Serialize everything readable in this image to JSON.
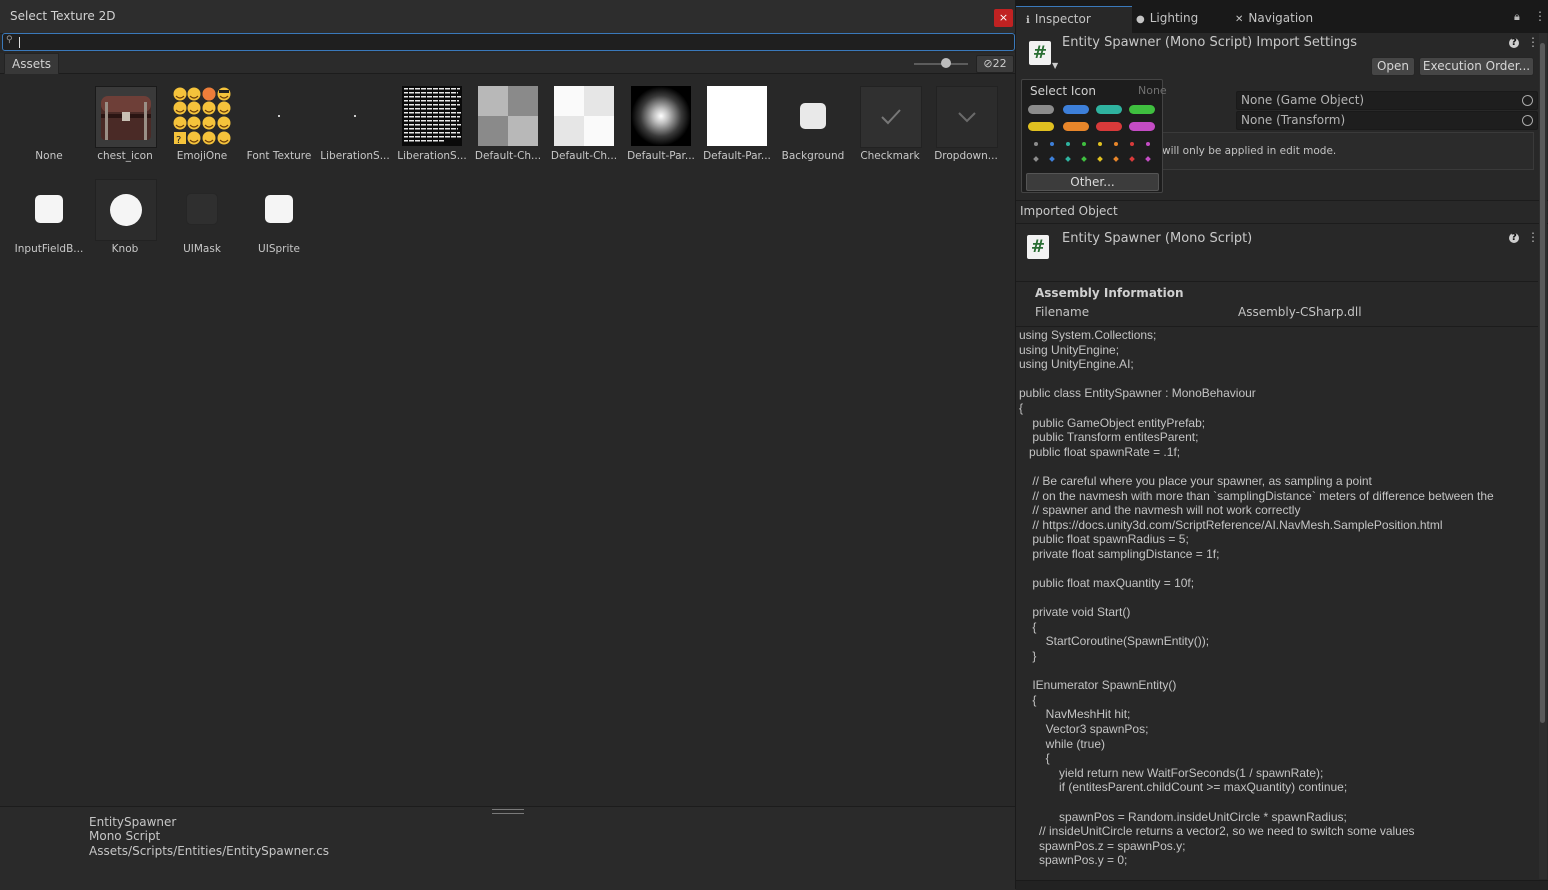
{
  "picker": {
    "title": "Select Texture 2D",
    "close_label": "×",
    "search": {
      "value": "",
      "placeholder": ""
    },
    "tab_label": "Assets",
    "hidden_count": "22",
    "assets": [
      {
        "name": "None"
      },
      {
        "name": "chest_icon"
      },
      {
        "name": "EmojiOne"
      },
      {
        "name": "Font Texture"
      },
      {
        "name": "LiberationS..."
      },
      {
        "name": "LiberationS..."
      },
      {
        "name": "Default-Ch..."
      },
      {
        "name": "Default-Ch..."
      },
      {
        "name": "Default-Par..."
      },
      {
        "name": "Default-Par..."
      },
      {
        "name": "Background"
      },
      {
        "name": "Checkmark"
      },
      {
        "name": "Dropdown..."
      },
      {
        "name": "InputFieldB..."
      },
      {
        "name": "Knob"
      },
      {
        "name": "UIMask"
      },
      {
        "name": "UISprite"
      }
    ],
    "preview": {
      "name": "EntitySpawner",
      "type": "Mono Script",
      "path": "Assets/Scripts/Entities/EntitySpawner.cs"
    }
  },
  "inspector": {
    "tabs": [
      {
        "label": "Inspector",
        "icon": "info-icon"
      },
      {
        "label": "Lighting",
        "icon": "bulb-icon"
      },
      {
        "label": "Navigation",
        "icon": "navigation-icon"
      }
    ],
    "header_title": "Entity Spawner (Mono Script) Import Settings",
    "buttons": {
      "open": "Open",
      "execution_order": "Execution Order..."
    },
    "fields": {
      "entity_prefab": "None (Game Object)",
      "entites_parent": "None (Transform)"
    },
    "edit_note": "will only be applied in edit mode.",
    "imported_object_label": "Imported Object",
    "imported_title": "Entity Spawner (Mono Script)",
    "assembly": {
      "heading": "Assembly Information",
      "filename_label": "Filename",
      "filename_value": "Assembly-CSharp.dll"
    },
    "code": "using System.Collections;\nusing UnityEngine;\nusing UnityEngine.AI;\n\npublic class EntitySpawner : MonoBehaviour\n{\n\tpublic GameObject entityPrefab;\n\tpublic Transform entitesParent;\n   public float spawnRate = .1f;\n\n\t// Be careful where you place your spawner, as sampling a point\n\t// on the navmesh with more than `samplingDistance` meters of difference between the\n\t// spawner and the navmesh will not work correctly\n\t// https://docs.unity3d.com/ScriptReference/AI.NavMesh.SamplePosition.html\n\tpublic float spawnRadius = 5;\n\tprivate float samplingDistance = 1f;\n\n\tpublic float maxQuantity = 10f;\n\n\tprivate void Start()\n\t{\n\t\tStartCoroutine(SpawnEntity());\n\t}\n\n\tIEnumerator SpawnEntity()\n\t{\n\t\tNavMeshHit hit;\n\t\tVector3 spawnPos;\n\t\twhile (true)\n\t\t{\n\t\t\tyield return new WaitForSeconds(1 / spawnRate);\n\t\t\tif (entitesParent.childCount >= maxQuantity) continue;\n\n\t\t\tspawnPos = Random.insideUnitCircle * spawnRadius;\n\t  // insideUnitCircle returns a vector2, so we need to switch some values\n\t  spawnPos.z = spawnPos.y;\n\t  spawnPos.y = 0;"
  },
  "icon_popup": {
    "title": "Select Icon",
    "none_label": "None",
    "other_label": "Other...",
    "colors": [
      "#8c8c8c",
      "#3d7fd9",
      "#2fb3a0",
      "#3fbf3f",
      "#e0c020",
      "#e8862a",
      "#d83a3a",
      "#c44cc4"
    ]
  }
}
